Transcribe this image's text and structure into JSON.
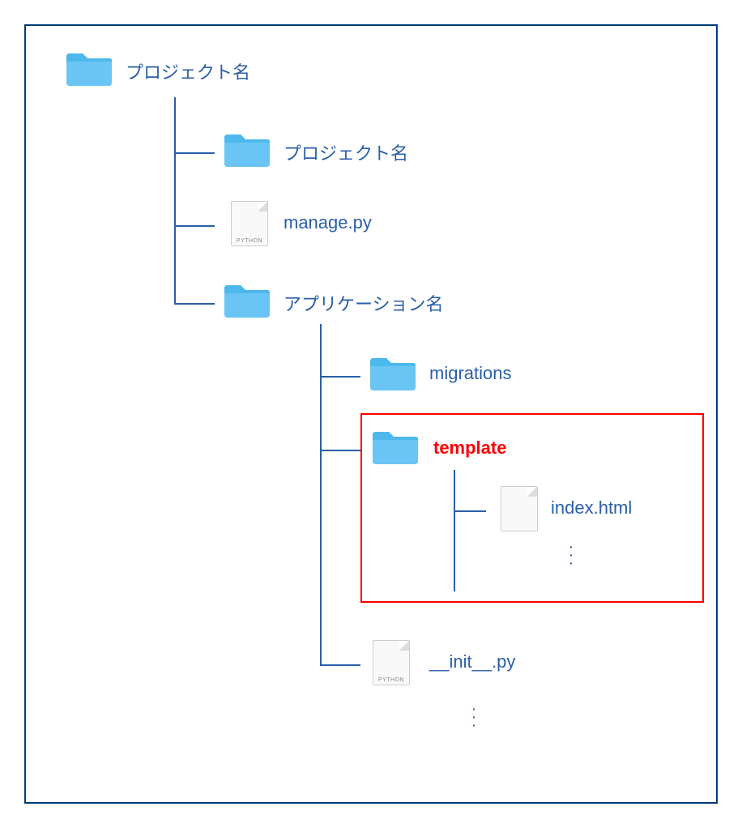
{
  "tree": {
    "root": "プロジェクト名",
    "project_sub": "プロジェクト名",
    "manage_py": "manage.py",
    "python_tag": "PYTHON",
    "app": "アプリケーション名",
    "migrations": "migrations",
    "template": "template",
    "index_html": "index.html",
    "init_py": "__init__.py"
  }
}
